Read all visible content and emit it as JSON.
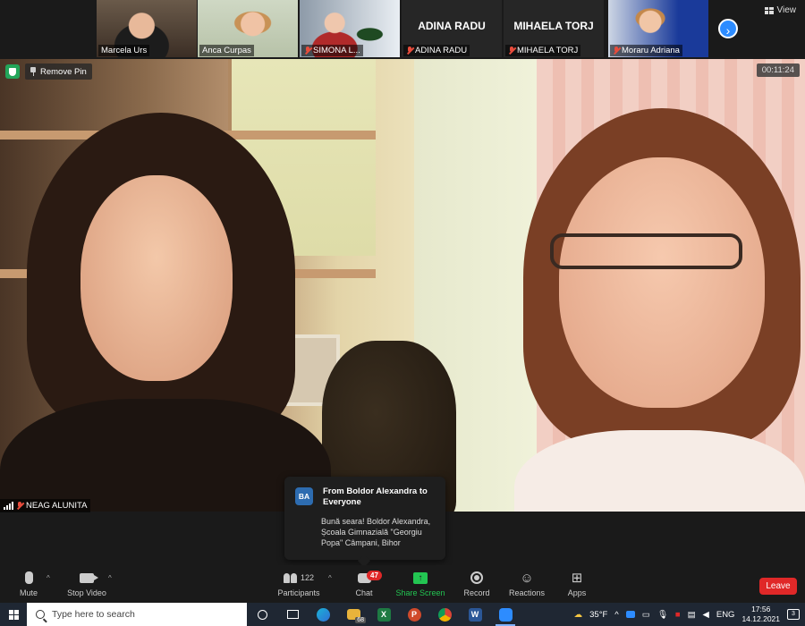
{
  "gallery": {
    "tiles": [
      {
        "name": "Marcela Urs",
        "muted": false
      },
      {
        "name": "Anca Curpas",
        "muted": false
      },
      {
        "name": "SIMONA L...",
        "muted": true
      },
      {
        "name": "ADINA RADU",
        "muted": true,
        "big_name": "ADINA RADU"
      },
      {
        "name": "MIHAELA TORJ",
        "muted": true,
        "big_name": "MIHAELA TORJ"
      },
      {
        "name": "Moraru Adriana",
        "muted": true
      }
    ],
    "next_icon": "chevron-right-icon",
    "view_label": "View"
  },
  "main": {
    "remove_pin_label": "Remove Pin",
    "timer": "00:11:24",
    "speaker_name": "NEAG ALUNITA"
  },
  "chat_popup": {
    "avatar_initials": "BA",
    "title": "From Boldor Alexandra to Everyone",
    "message": "Bună seara! Boldor Alexandra, Școala Gimnazială \"Georgiu Popa\" Câmpani, Bihor"
  },
  "toolbar": {
    "mute_label": "Mute",
    "stop_video_label": "Stop Video",
    "participants_count": "122",
    "participants_label": "Participants",
    "chat_badge": "47",
    "chat_label": "Chat",
    "share_label": "Share Screen",
    "record_label": "Record",
    "reactions_label": "Reactions",
    "apps_label": "Apps",
    "leave_label": "Leave",
    "share_color": "#23c552",
    "leave_color": "#e02828"
  },
  "taskbar": {
    "search_placeholder": "Type here to search",
    "edge_badge": "68",
    "weather": "35°F",
    "language": "ENG",
    "time": "17:56",
    "date": "14.12.2021",
    "notifications": "3"
  }
}
